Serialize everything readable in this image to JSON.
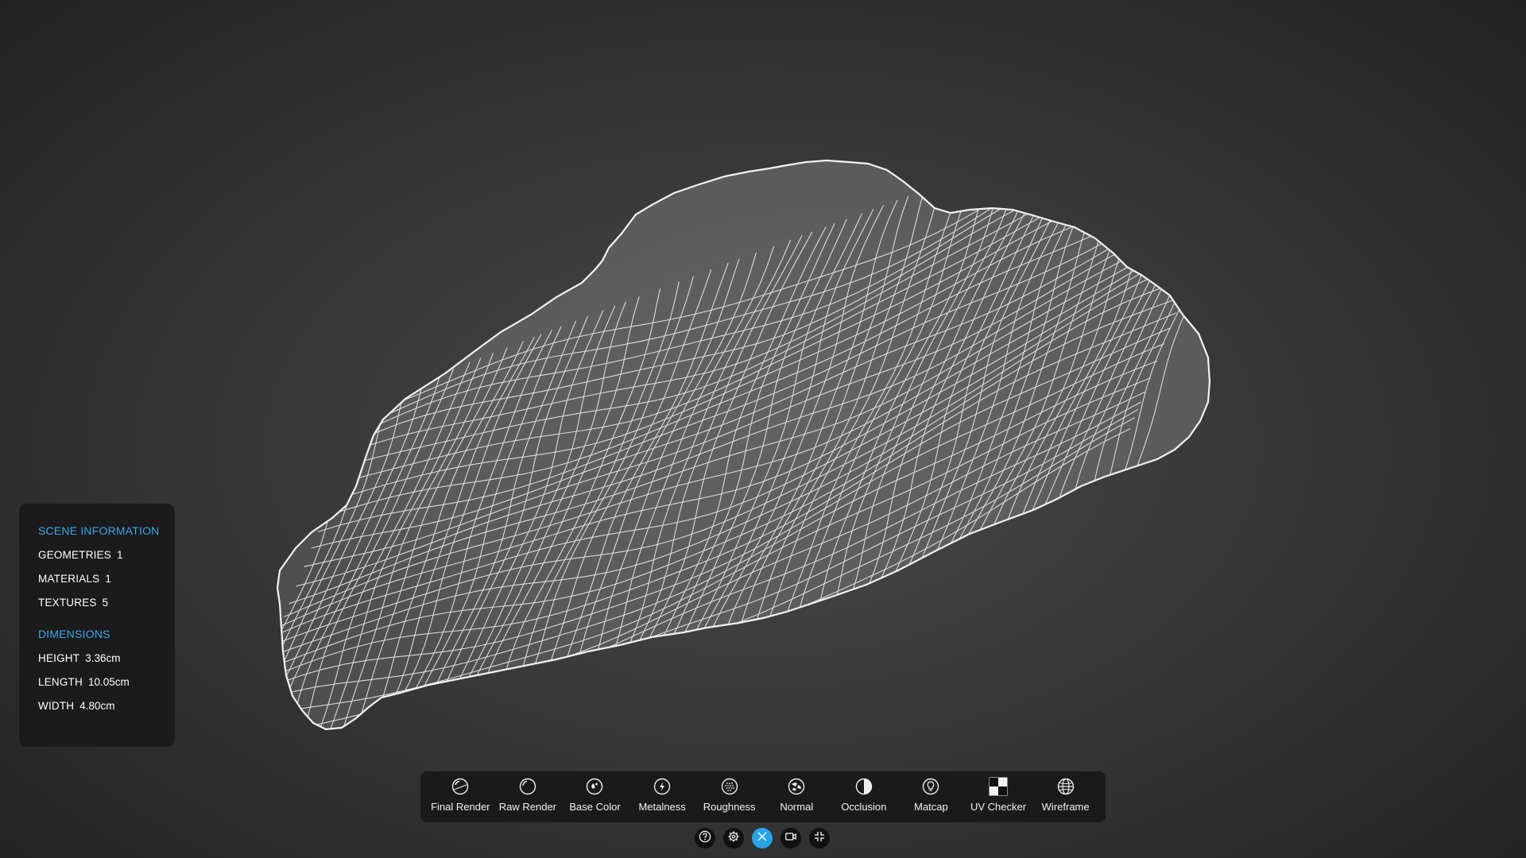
{
  "scene_info": {
    "title": "SCENE INFORMATION",
    "rows": [
      {
        "key": "GEOMETRIES",
        "value": "1"
      },
      {
        "key": "MATERIALS",
        "value": "1"
      },
      {
        "key": "TEXTURES",
        "value": "5"
      }
    ]
  },
  "dimensions": {
    "title": "DIMENSIONS",
    "rows": [
      {
        "key": "HEIGHT",
        "value": "3.36cm"
      },
      {
        "key": "LENGTH",
        "value": "10.05cm"
      },
      {
        "key": "WIDTH",
        "value": "4.80cm"
      }
    ]
  },
  "toolbar": {
    "items": [
      {
        "label": "Final Render",
        "icon": "final-render-icon"
      },
      {
        "label": "Raw Render",
        "icon": "raw-render-icon"
      },
      {
        "label": "Base Color",
        "icon": "base-color-icon"
      },
      {
        "label": "Metalness",
        "icon": "metalness-icon"
      },
      {
        "label": "Roughness",
        "icon": "roughness-icon"
      },
      {
        "label": "Normal",
        "icon": "normal-icon"
      },
      {
        "label": "Occlusion",
        "icon": "occlusion-icon"
      },
      {
        "label": "Matcap",
        "icon": "matcap-icon"
      },
      {
        "label": "UV Checker",
        "icon": "uv-checker-icon"
      },
      {
        "label": "Wireframe",
        "icon": "wireframe-icon"
      }
    ]
  },
  "controls": [
    {
      "icon": "help-icon"
    },
    {
      "icon": "settings-icon"
    },
    {
      "icon": "close-icon",
      "active": true
    },
    {
      "icon": "video-camera-icon"
    },
    {
      "icon": "exit-fullscreen-icon"
    }
  ],
  "colors": {
    "accent": "#27a3ea",
    "heading": "#3aa6ee",
    "panel": "#1b1b1b",
    "mesh_fill": "#5d5d5d",
    "mesh_wire": "#e8e8e8"
  }
}
